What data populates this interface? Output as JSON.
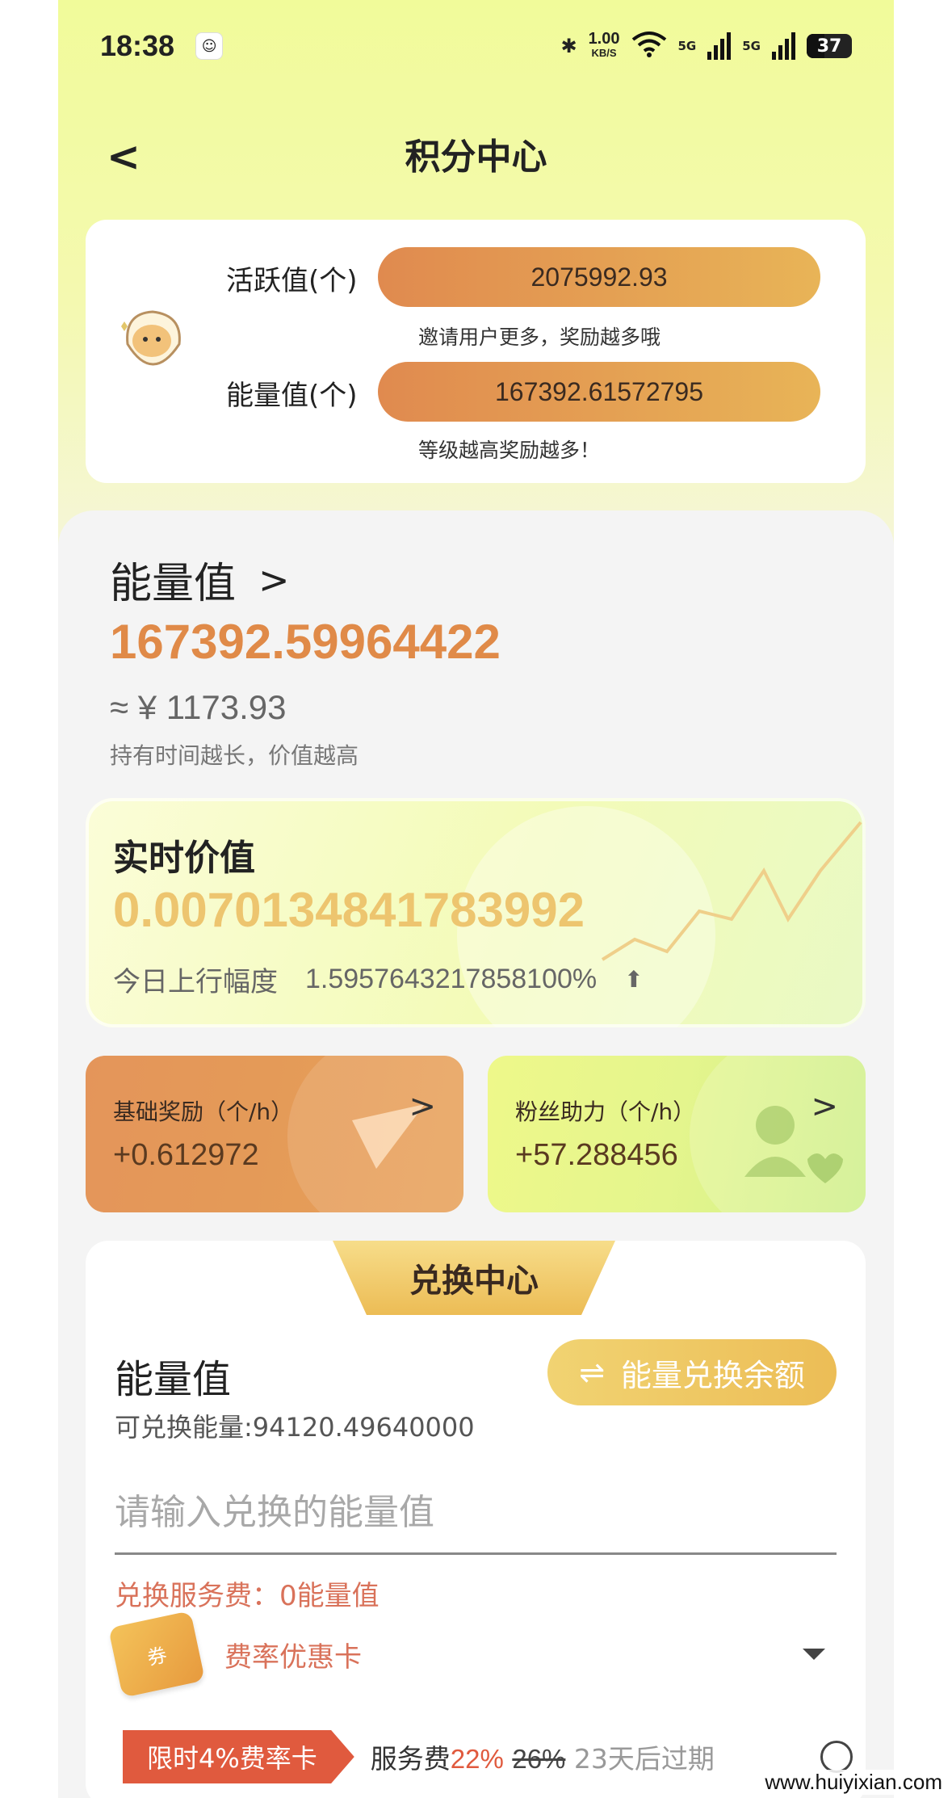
{
  "status_bar": {
    "time": "18:38",
    "speed_value": "1.00",
    "speed_unit": "KB/S",
    "net1": "5G",
    "net2": "5G",
    "battery": "37"
  },
  "nav": {
    "title": "积分中心"
  },
  "stats": {
    "activity_label": "活跃值(个)",
    "activity_value": "2075992.93",
    "activity_hint": "邀请用户更多，奖励越多哦",
    "energy_label": "能量值(个)",
    "energy_value": "167392.61572795",
    "energy_hint": "等级越高奖励越多！"
  },
  "energy": {
    "title": "能量值",
    "value": "167392.59964422",
    "cny": "≈ ¥ 1173.93",
    "hint": "持有时间越长，价值越高"
  },
  "realtime": {
    "title": "实时价值",
    "value": "0.0070134841783992",
    "change_label": "今日上行幅度",
    "change_value": "1.595764321785810​0%"
  },
  "rewards": {
    "base_label": "基础奖励（个/h）",
    "base_value": "+0.612972",
    "fans_label": "粉丝助力（个/h）",
    "fans_value": "+57.288456"
  },
  "exchange": {
    "tab": "兑换中心",
    "label": "能量值",
    "available": "可兑换能量:94120.49640000",
    "button_label": "能量兑换余额",
    "input_placeholder": "请输入兑换的能量值",
    "fee": "兑换服务费：0能量值",
    "coupon_label": "费率优惠卡",
    "promo_tag": "限时4%费率卡",
    "promo_fee_label": "服务费",
    "promo_new_rate": "22%",
    "promo_old_rate": "26%",
    "promo_expire": "23天后过期"
  },
  "watermark": "www.huiyixian.com",
  "colors": {
    "accent_orange": "#e08a48",
    "realtime_gold": "#edc56f",
    "promo_red": "#e05a3e"
  }
}
